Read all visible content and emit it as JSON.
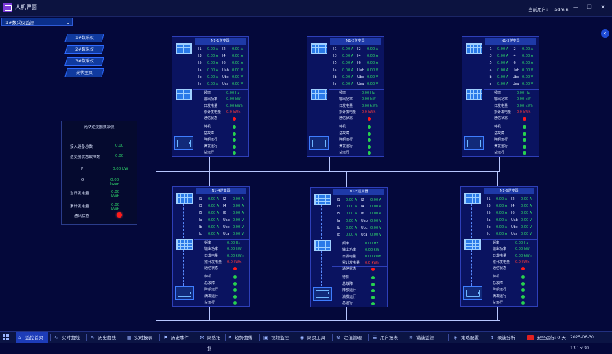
{
  "window": {
    "title": "人机界面",
    "user_label": "当前用户:",
    "user_name": "admin",
    "min_icon": "minimize-icon",
    "max_icon": "maximize-icon",
    "close_icon": "close-icon"
  },
  "selector": {
    "value": "1#数采仪监测"
  },
  "nav": [
    "1#数采仪",
    "2#数采仪",
    "3#数采仪",
    "光伏主页"
  ],
  "summary": {
    "title": "光伏逆变器数采仪",
    "rows": [
      {
        "label": "接入设备总数",
        "value": "0.00"
      },
      {
        "label": "逆变器状态故障数",
        "value": "0.00"
      },
      {
        "label": "P",
        "value": "0.00 kW"
      },
      {
        "label": "Q",
        "value": "0.00 kvar"
      },
      {
        "label": "当日发电量",
        "value": "0.00 kWh"
      },
      {
        "label": "累计发电量",
        "value": "0.00 kWh"
      },
      {
        "label": "通讯状态",
        "value": ""
      }
    ],
    "comm_status": "fault"
  },
  "inverters": [
    {
      "title": "N1-1逆变器"
    },
    {
      "title": "N1-2逆变器"
    },
    {
      "title": "N1-3逆变器"
    },
    {
      "title": "N1-4逆变器"
    },
    {
      "title": "N1-5逆变器"
    },
    {
      "title": "N1-6逆变器"
    }
  ],
  "inverter_fields": {
    "currents": [
      {
        "l1": "I1",
        "v1": "0.00 A",
        "l2": "I2",
        "v2": "0.00 A"
      },
      {
        "l1": "I3",
        "v1": "0.00 A",
        "l2": "I4",
        "v2": "0.00 A"
      },
      {
        "l1": "I5",
        "v1": "0.00 A",
        "l2": "I6",
        "v2": "0.00 A"
      },
      {
        "l1": "Ia",
        "v1": "0.00 A",
        "l2": "Uab",
        "v2": "0.00 V"
      },
      {
        "l1": "Ib",
        "v1": "0.00 A",
        "l2": "Ubc",
        "v2": "0.00 V"
      },
      {
        "l1": "Ic",
        "v1": "0.00 A",
        "l2": "Uca",
        "v2": "0.00 V"
      }
    ],
    "power": [
      {
        "label": "频率",
        "value": "0.00 Hz"
      },
      {
        "label": "输出功率",
        "value": "0.00 kW"
      },
      {
        "label": "日发电量",
        "value": "0.00 kWh"
      },
      {
        "label": "累计发电量",
        "value": "0.0 kWh"
      }
    ],
    "status": [
      {
        "label": "通信状态",
        "state": "fault"
      },
      {
        "label": "待机",
        "state": "ok"
      },
      {
        "label": "总故障",
        "state": "ok"
      },
      {
        "label": "降额运行",
        "state": "ok"
      },
      {
        "label": "满发运行",
        "state": "ok"
      },
      {
        "label": "总运行",
        "state": "ok"
      }
    ]
  },
  "taskbar": {
    "items": [
      {
        "label": "监控首页",
        "icon": "home-icon",
        "active": true
      },
      {
        "label": "实时曲线",
        "icon": "line-chart-icon",
        "active": false
      },
      {
        "label": "历史曲线",
        "icon": "history-chart-icon",
        "active": false
      },
      {
        "label": "实时报表",
        "icon": "report-icon",
        "active": false
      },
      {
        "label": "历史事件",
        "icon": "event-icon",
        "active": false
      },
      {
        "label": "网络拓扑",
        "icon": "topology-icon",
        "active": false
      },
      {
        "label": "趋势曲线",
        "icon": "trend-icon",
        "active": false
      },
      {
        "label": "视频监控",
        "icon": "camera-icon",
        "active": false
      },
      {
        "label": "网页工具",
        "icon": "web-icon",
        "active": false
      },
      {
        "label": "定值管理",
        "icon": "settings-icon",
        "active": false
      },
      {
        "label": "用户报表",
        "icon": "user-report-icon",
        "active": false
      },
      {
        "label": "谐波监测",
        "icon": "wave-icon",
        "active": false
      },
      {
        "label": "策略配置",
        "icon": "strategy-icon",
        "active": false
      },
      {
        "label": "录波分析",
        "icon": "recorder-icon",
        "active": false
      }
    ],
    "run_text": "安全运行: 0 天",
    "datetime": "2025-06-30 13:15:30"
  },
  "colors": {
    "background": "#04083a",
    "value_green": "#2fd66b",
    "alarm_red": "#ff1a1a",
    "panel": "#0a1360",
    "accent": "#1d3cb8"
  }
}
